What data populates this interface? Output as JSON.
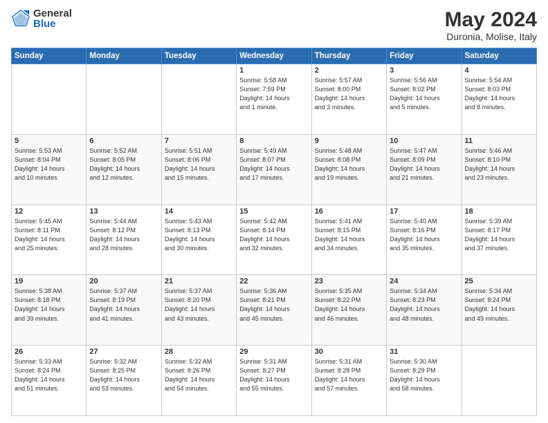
{
  "header": {
    "logo_general": "General",
    "logo_blue": "Blue",
    "title": "May 2024",
    "subtitle": "Duronia, Molise, Italy"
  },
  "days_of_week": [
    "Sunday",
    "Monday",
    "Tuesday",
    "Wednesday",
    "Thursday",
    "Friday",
    "Saturday"
  ],
  "weeks": [
    [
      {
        "day": "",
        "info": ""
      },
      {
        "day": "",
        "info": ""
      },
      {
        "day": "",
        "info": ""
      },
      {
        "day": "1",
        "info": "Sunrise: 5:58 AM\nSunset: 7:59 PM\nDaylight: 14 hours\nand 1 minute."
      },
      {
        "day": "2",
        "info": "Sunrise: 5:57 AM\nSunset: 8:00 PM\nDaylight: 14 hours\nand 3 minutes."
      },
      {
        "day": "3",
        "info": "Sunrise: 5:56 AM\nSunset: 8:02 PM\nDaylight: 14 hours\nand 5 minutes."
      },
      {
        "day": "4",
        "info": "Sunrise: 5:54 AM\nSunset: 8:03 PM\nDaylight: 14 hours\nand 8 minutes."
      }
    ],
    [
      {
        "day": "5",
        "info": "Sunrise: 5:53 AM\nSunset: 8:04 PM\nDaylight: 14 hours\nand 10 minutes."
      },
      {
        "day": "6",
        "info": "Sunrise: 5:52 AM\nSunset: 8:05 PM\nDaylight: 14 hours\nand 12 minutes."
      },
      {
        "day": "7",
        "info": "Sunrise: 5:51 AM\nSunset: 8:06 PM\nDaylight: 14 hours\nand 15 minutes."
      },
      {
        "day": "8",
        "info": "Sunrise: 5:49 AM\nSunset: 8:07 PM\nDaylight: 14 hours\nand 17 minutes."
      },
      {
        "day": "9",
        "info": "Sunrise: 5:48 AM\nSunset: 8:08 PM\nDaylight: 14 hours\nand 19 minutes."
      },
      {
        "day": "10",
        "info": "Sunrise: 5:47 AM\nSunset: 8:09 PM\nDaylight: 14 hours\nand 21 minutes."
      },
      {
        "day": "11",
        "info": "Sunrise: 5:46 AM\nSunset: 8:10 PM\nDaylight: 14 hours\nand 23 minutes."
      }
    ],
    [
      {
        "day": "12",
        "info": "Sunrise: 5:45 AM\nSunset: 8:11 PM\nDaylight: 14 hours\nand 25 minutes."
      },
      {
        "day": "13",
        "info": "Sunrise: 5:44 AM\nSunset: 8:12 PM\nDaylight: 14 hours\nand 28 minutes."
      },
      {
        "day": "14",
        "info": "Sunrise: 5:43 AM\nSunset: 8:13 PM\nDaylight: 14 hours\nand 30 minutes."
      },
      {
        "day": "15",
        "info": "Sunrise: 5:42 AM\nSunset: 8:14 PM\nDaylight: 14 hours\nand 32 minutes."
      },
      {
        "day": "16",
        "info": "Sunrise: 5:41 AM\nSunset: 8:15 PM\nDaylight: 14 hours\nand 34 minutes."
      },
      {
        "day": "17",
        "info": "Sunrise: 5:40 AM\nSunset: 8:16 PM\nDaylight: 14 hours\nand 35 minutes."
      },
      {
        "day": "18",
        "info": "Sunrise: 5:39 AM\nSunset: 8:17 PM\nDaylight: 14 hours\nand 37 minutes."
      }
    ],
    [
      {
        "day": "19",
        "info": "Sunrise: 5:38 AM\nSunset: 8:18 PM\nDaylight: 14 hours\nand 39 minutes."
      },
      {
        "day": "20",
        "info": "Sunrise: 5:37 AM\nSunset: 8:19 PM\nDaylight: 14 hours\nand 41 minutes."
      },
      {
        "day": "21",
        "info": "Sunrise: 5:37 AM\nSunset: 8:20 PM\nDaylight: 14 hours\nand 43 minutes."
      },
      {
        "day": "22",
        "info": "Sunrise: 5:36 AM\nSunset: 8:21 PM\nDaylight: 14 hours\nand 45 minutes."
      },
      {
        "day": "23",
        "info": "Sunrise: 5:35 AM\nSunset: 8:22 PM\nDaylight: 14 hours\nand 46 minutes."
      },
      {
        "day": "24",
        "info": "Sunrise: 5:34 AM\nSunset: 8:23 PM\nDaylight: 14 hours\nand 48 minutes."
      },
      {
        "day": "25",
        "info": "Sunrise: 5:34 AM\nSunset: 8:24 PM\nDaylight: 14 hours\nand 49 minutes."
      }
    ],
    [
      {
        "day": "26",
        "info": "Sunrise: 5:33 AM\nSunset: 8:24 PM\nDaylight: 14 hours\nand 51 minutes."
      },
      {
        "day": "27",
        "info": "Sunrise: 5:32 AM\nSunset: 8:25 PM\nDaylight: 14 hours\nand 53 minutes."
      },
      {
        "day": "28",
        "info": "Sunrise: 5:32 AM\nSunset: 8:26 PM\nDaylight: 14 hours\nand 54 minutes."
      },
      {
        "day": "29",
        "info": "Sunrise: 5:31 AM\nSunset: 8:27 PM\nDaylight: 14 hours\nand 55 minutes."
      },
      {
        "day": "30",
        "info": "Sunrise: 5:31 AM\nSunset: 8:28 PM\nDaylight: 14 hours\nand 57 minutes."
      },
      {
        "day": "31",
        "info": "Sunrise: 5:30 AM\nSunset: 8:29 PM\nDaylight: 14 hours\nand 58 minutes."
      },
      {
        "day": "",
        "info": ""
      }
    ]
  ]
}
